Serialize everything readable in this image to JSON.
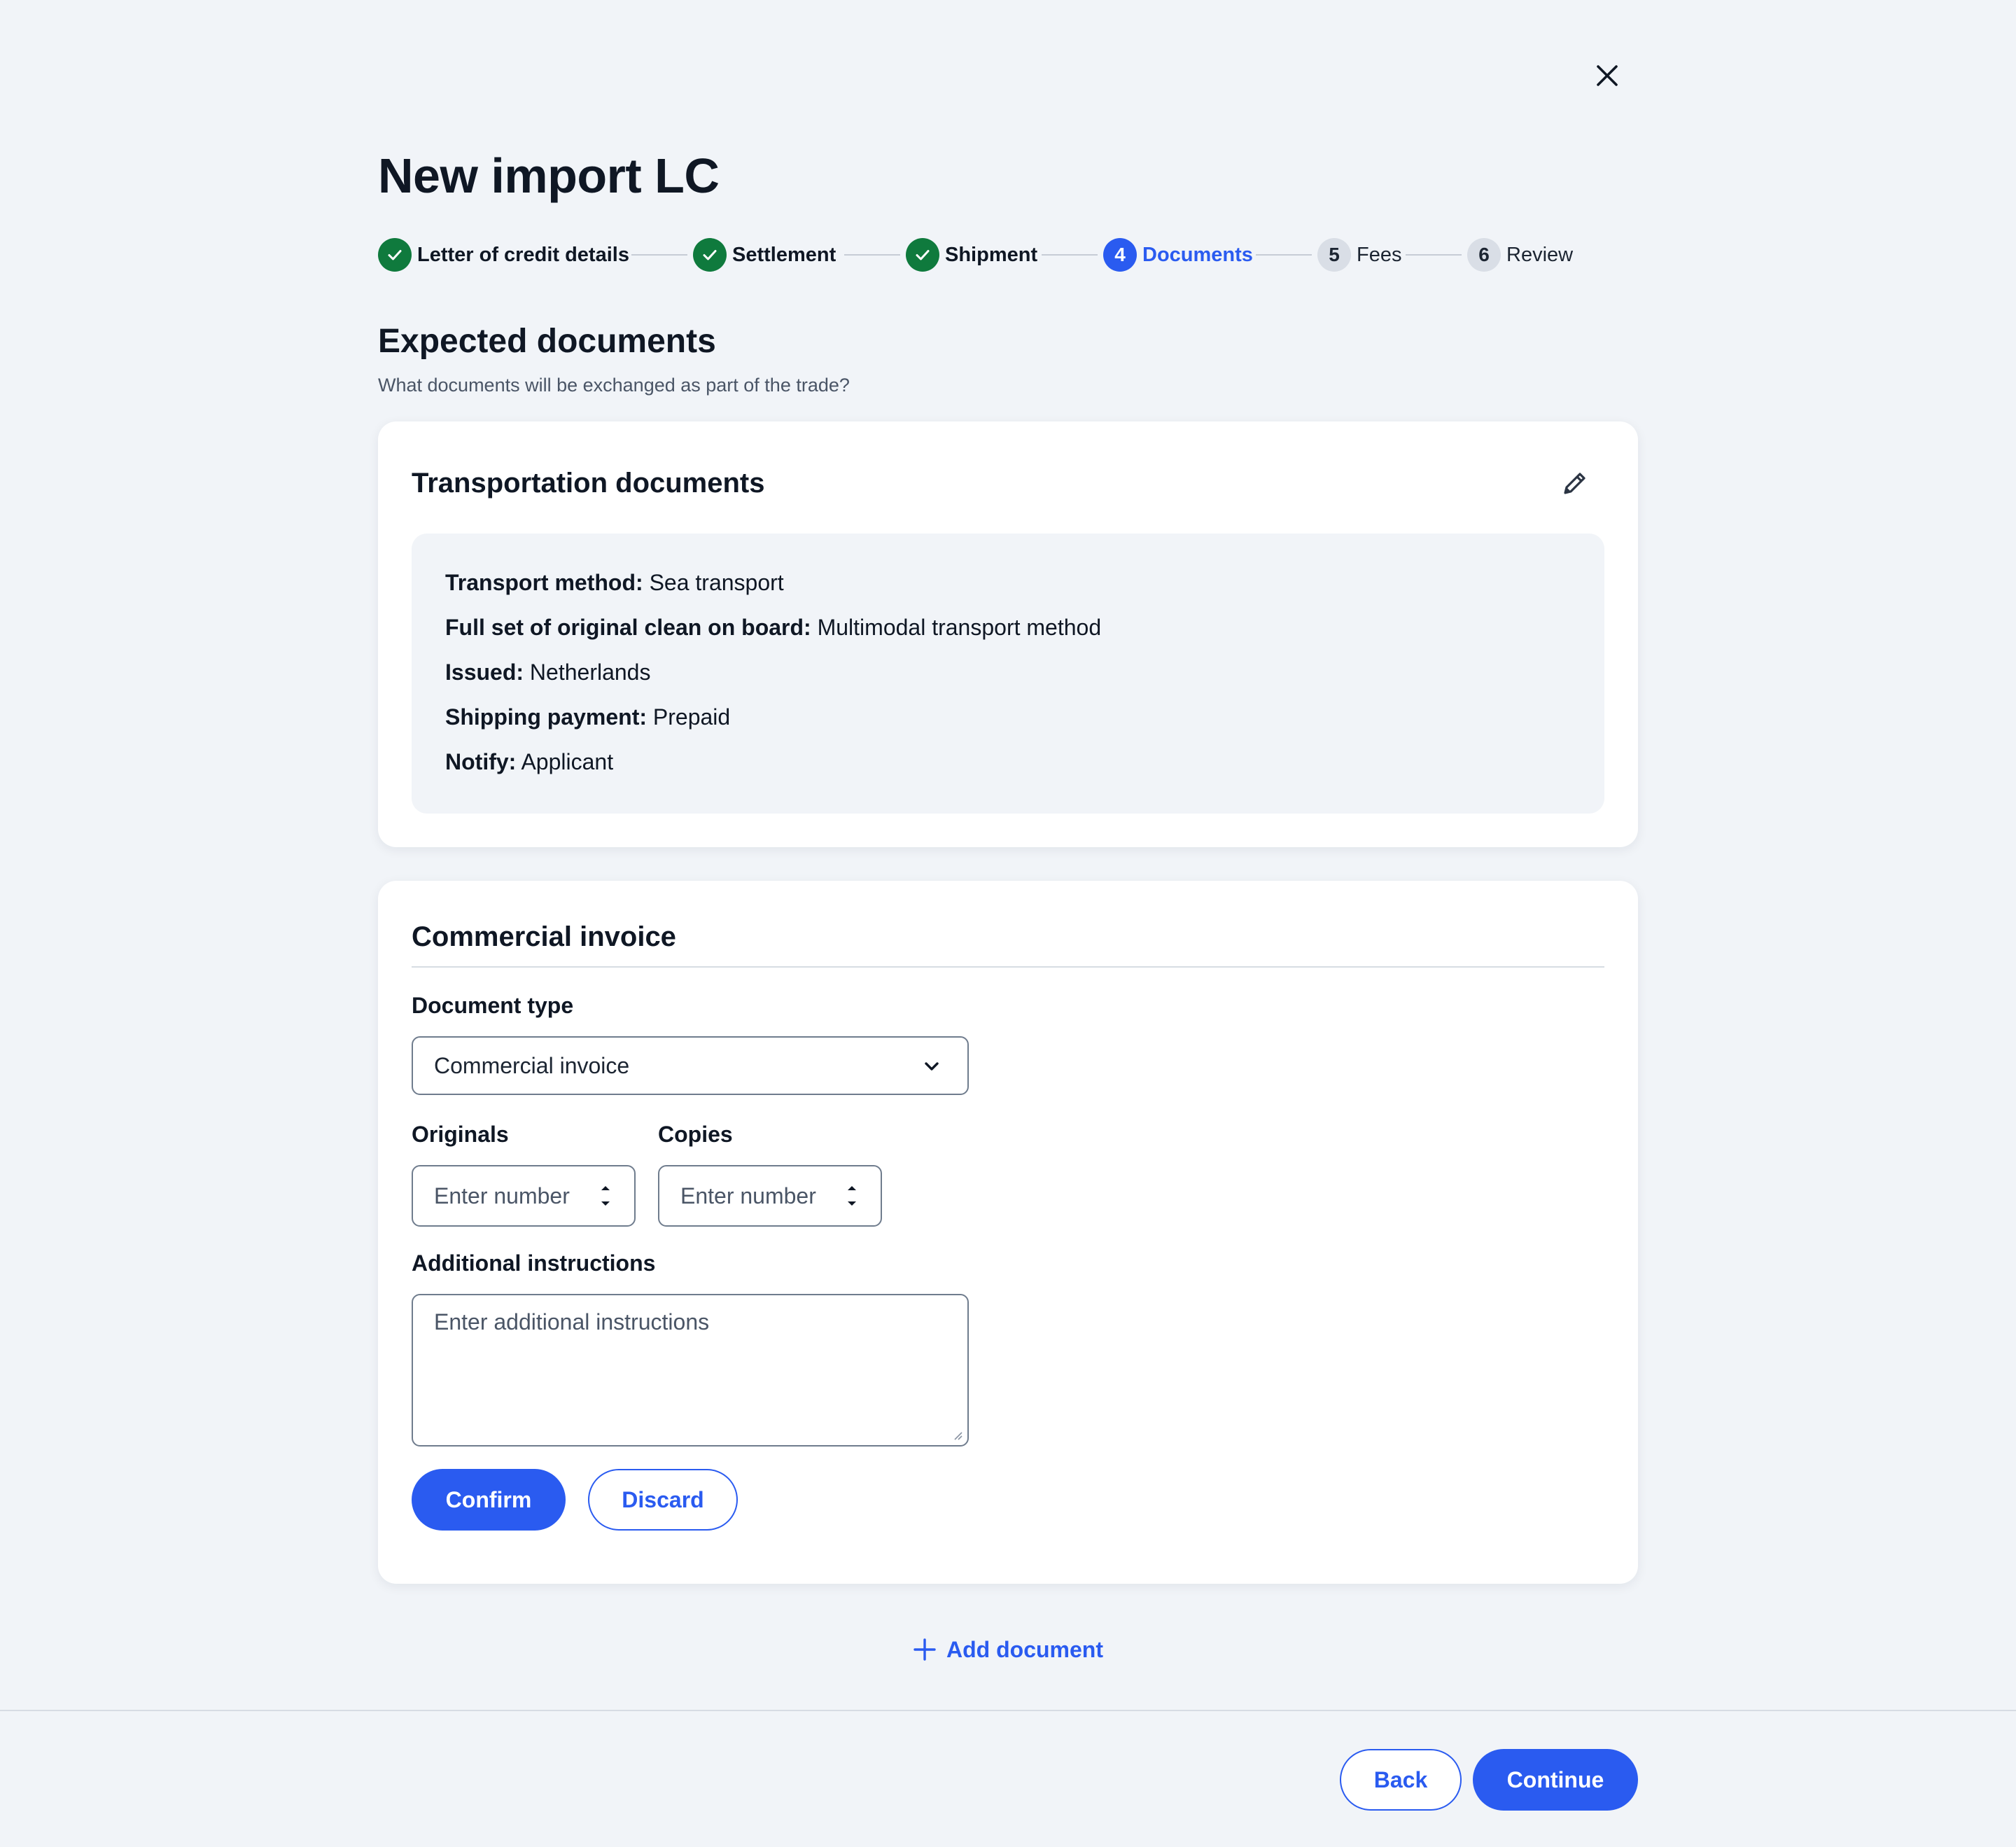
{
  "header": {
    "title": "New import LC",
    "close_icon": "close-icon"
  },
  "stepper": {
    "steps": [
      {
        "number": "1",
        "label": "Letter of credit details",
        "status": "complete"
      },
      {
        "number": "2",
        "label": "Settlement",
        "status": "complete"
      },
      {
        "number": "3",
        "label": "Shipment",
        "status": "complete"
      },
      {
        "number": "4",
        "label": "Documents",
        "status": "active"
      },
      {
        "number": "5",
        "label": "Fees",
        "status": "upcoming"
      },
      {
        "number": "6",
        "label": "Review",
        "status": "upcoming"
      }
    ]
  },
  "section": {
    "title": "Expected documents",
    "subtitle": "What documents will be exchanged as part of the trade?"
  },
  "transport_card": {
    "title": "Transportation documents",
    "edit_icon": "pencil-icon",
    "rows": [
      {
        "label": "Transport method:",
        "value": "Sea transport"
      },
      {
        "label": "Full set of original clean on board:",
        "value": "Multimodal transport method"
      },
      {
        "label": "Issued:",
        "value": "Netherlands"
      },
      {
        "label": "Shipping payment:",
        "value": "Prepaid"
      },
      {
        "label": "Notify:",
        "value": "Applicant"
      }
    ]
  },
  "invoice_card": {
    "title": "Commercial invoice",
    "document_type": {
      "label": "Document type",
      "value": "Commercial invoice"
    },
    "originals": {
      "label": "Originals",
      "placeholder": "Enter number"
    },
    "copies": {
      "label": "Copies",
      "placeholder": "Enter number"
    },
    "instructions": {
      "label": "Additional instructions",
      "placeholder": "Enter additional instructions"
    },
    "confirm_label": "Confirm",
    "discard_label": "Discard"
  },
  "add_document_label": "Add document",
  "footer": {
    "back_label": "Back",
    "continue_label": "Continue"
  },
  "colors": {
    "primary": "#2a5bf0",
    "complete": "#0f7a3d",
    "background": "#f1f4f8",
    "text": "#0f1724"
  }
}
